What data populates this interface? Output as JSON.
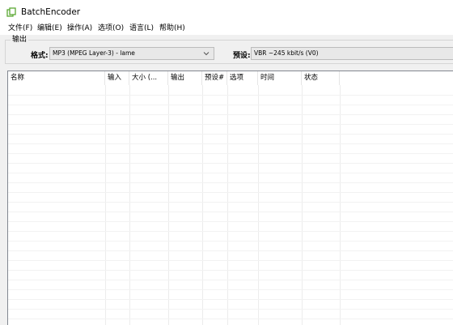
{
  "window": {
    "title": "BatchEncoder",
    "icon": "app-icon"
  },
  "menu": [
    {
      "label": "文件(F)"
    },
    {
      "label": "编辑(E)"
    },
    {
      "label": "操作(A)"
    },
    {
      "label": "选项(O)"
    },
    {
      "label": "语言(L)"
    },
    {
      "label": "帮助(H)"
    }
  ],
  "output_group": {
    "title": "输出",
    "format_label": "格式:",
    "format_value": "MP3 (MPEG Layer-3) - lame",
    "preset_label": "预设:",
    "preset_value": "VBR ~245 kbit/s (V0)"
  },
  "list": {
    "columns": [
      "名称",
      "输入",
      "大小 (...",
      "输出",
      "预设#",
      "选项",
      "时间",
      "状态"
    ],
    "rows": []
  },
  "colors": {
    "titlebar_bg": "#ffffff",
    "window_bg": "#f0f0f0",
    "list_bg": "#ffffff",
    "app_icon_green": "#5aa832"
  }
}
